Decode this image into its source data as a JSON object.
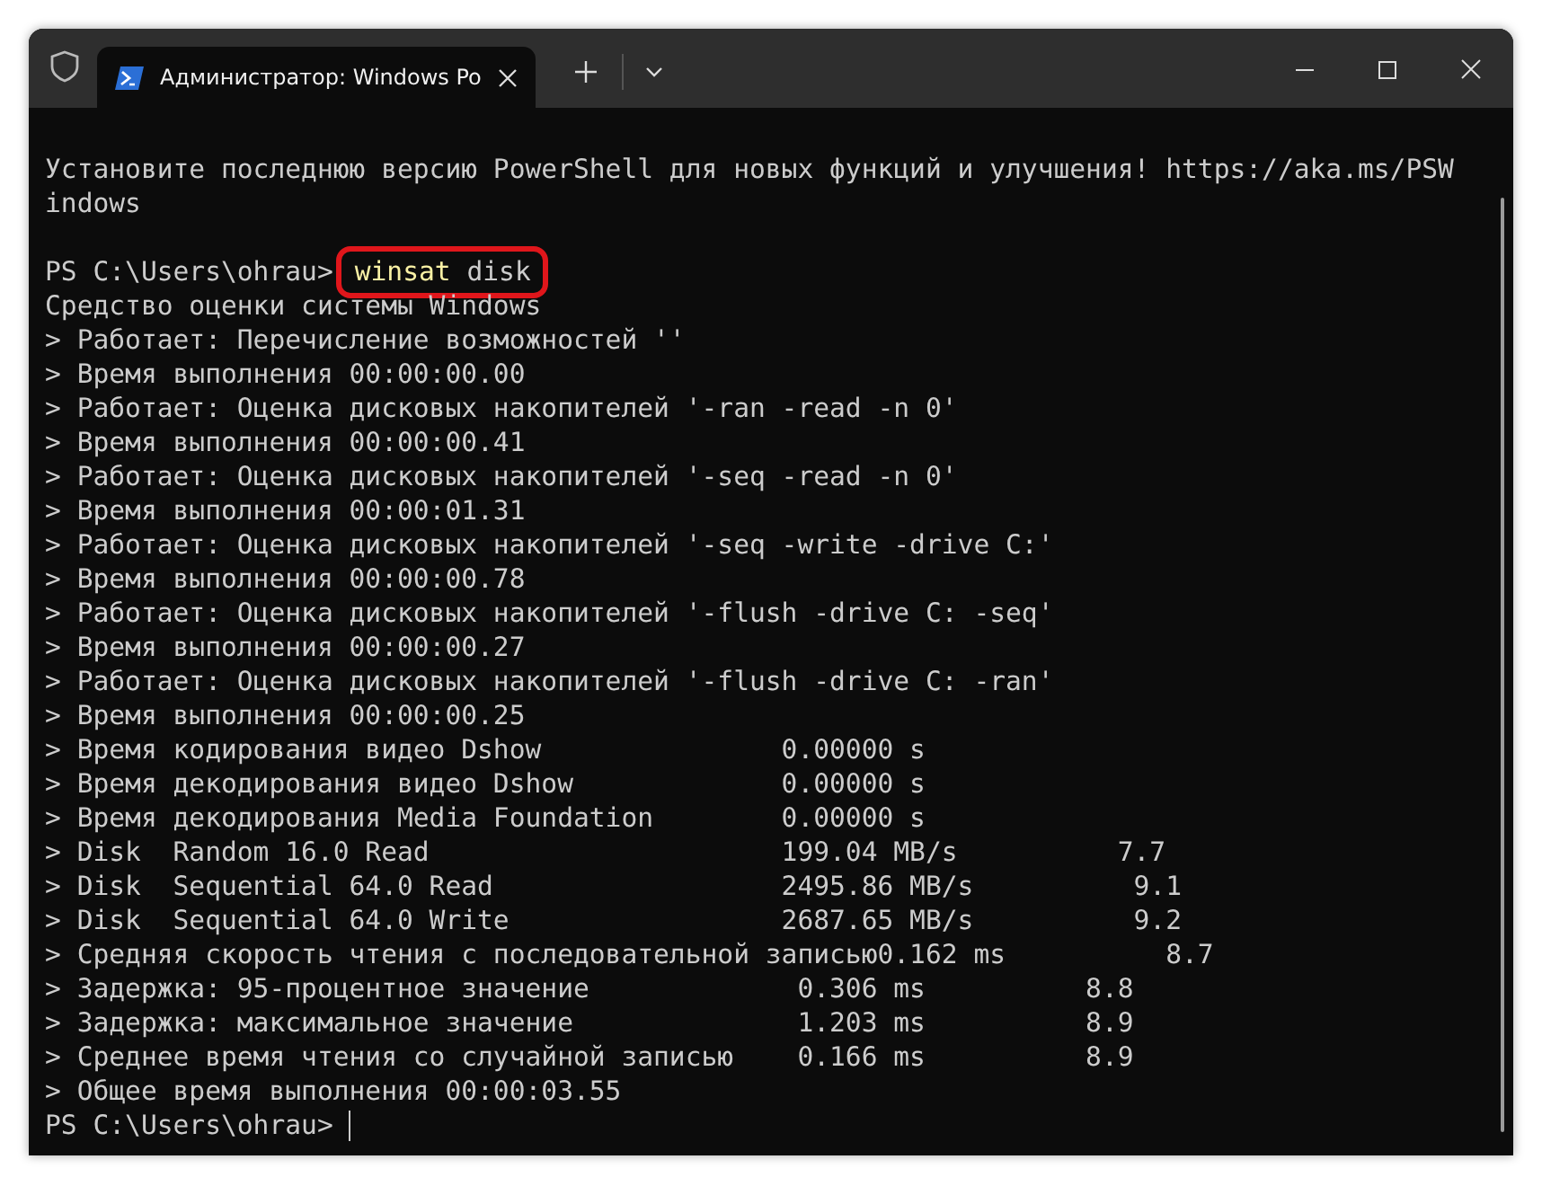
{
  "window": {
    "tab_title": "Администратор: Windows Po"
  },
  "terminal": {
    "banner": [
      "Установите последнюю версию PowerShell для новых функций и улучшения! https://aka.ms/PSW",
      "indows"
    ],
    "prompt": "PS C:\\Users\\ohrau>",
    "command_name": "winsat",
    "command_args": "disk",
    "command_highlighted": true,
    "output": [
      "Средство оценки системы Windows",
      "> Работает: Перечисление возможностей ''",
      "> Время выполнения 00:00:00.00",
      "> Работает: Оценка дисковых накопителей '-ran -read -n 0'",
      "> Время выполнения 00:00:00.41",
      "> Работает: Оценка дисковых накопителей '-seq -read -n 0'",
      "> Время выполнения 00:00:01.31",
      "> Работает: Оценка дисковых накопителей '-seq -write -drive C:'",
      "> Время выполнения 00:00:00.78",
      "> Работает: Оценка дисковых накопителей '-flush -drive C: -seq'",
      "> Время выполнения 00:00:00.27",
      "> Работает: Оценка дисковых накопителей '-flush -drive C: -ran'",
      "> Время выполнения 00:00:00.25",
      "> Время кодирования видео Dshow               0.00000 s",
      "> Время декодирования видео Dshow             0.00000 s",
      "> Время декодирования Media Foundation        0.00000 s",
      "> Disk  Random 16.0 Read                      199.04 MB/s          7.7",
      "> Disk  Sequential 64.0 Read                  2495.86 MB/s          9.1",
      "> Disk  Sequential 64.0 Write                 2687.65 MB/s          9.2",
      "> Средняя скорость чтения с последовательной записью0.162 ms          8.7",
      "> Задержка: 95-процентное значение             0.306 ms          8.8",
      "> Задержка: максимальное значение              1.203 ms          8.9",
      "> Среднее время чтения со случайной записью    0.166 ms          8.9",
      "> Общее время выполнения 00:00:03.55"
    ],
    "final_prompt": "PS C:\\Users\\ohrau>"
  }
}
